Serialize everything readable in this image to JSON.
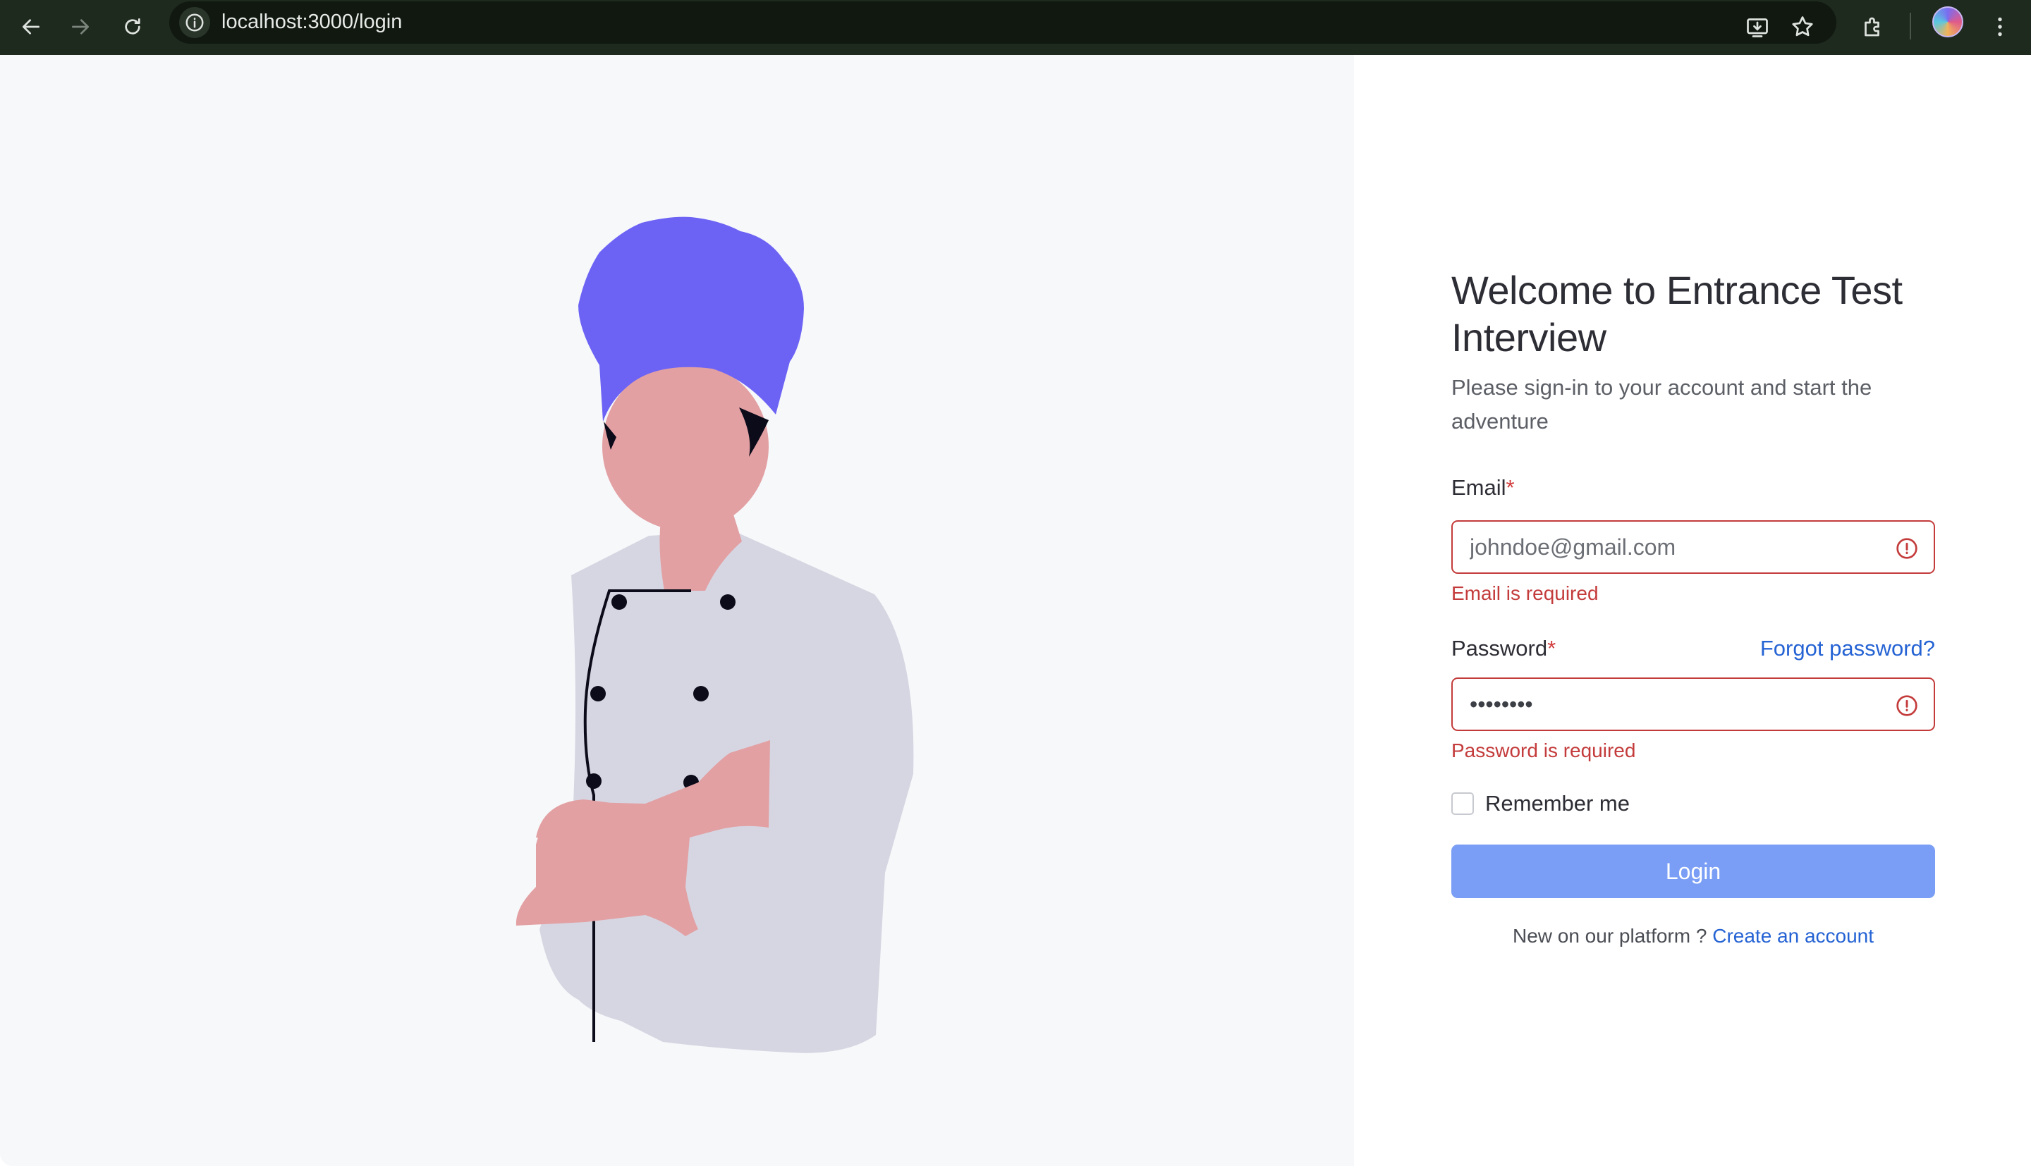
{
  "browser": {
    "url": "localhost:3000/login",
    "icons": [
      "back-arrow-icon",
      "forward-arrow-icon",
      "reload-icon",
      "site-info-icon",
      "install-app-icon",
      "bookmark-star-icon",
      "extensions-icon",
      "profile-avatar",
      "more-menu-icon"
    ]
  },
  "illustration": {
    "colors": {
      "hat": "#6c63f5",
      "skin": "#e2a0a3",
      "jacket": "#d6d6e2",
      "hair": "#0b0b1a",
      "buttons": "#0b0b1a",
      "background": "#f7f8fa"
    }
  },
  "form": {
    "title": "Welcome to Entrance Test Interview",
    "subtitle": "Please sign-in to your account and start the adventure",
    "email": {
      "label": "Email",
      "required_mark": "*",
      "placeholder": "johndoe@gmail.com",
      "value": "",
      "error": "Email is required"
    },
    "password": {
      "label": "Password",
      "required_mark": "*",
      "value": "········",
      "error": "Password is required"
    },
    "forgot_password": "Forgot password?",
    "remember_me": "Remember me",
    "remember_checked": false,
    "login_button": "Login",
    "signup_prompt": "New on our platform ?",
    "signup_link": "Create an account"
  },
  "colors": {
    "error": "#c43b3b",
    "link": "#2563d4",
    "login_button": "#7a9ef5",
    "chrome_bg": "#1f2a1f"
  }
}
